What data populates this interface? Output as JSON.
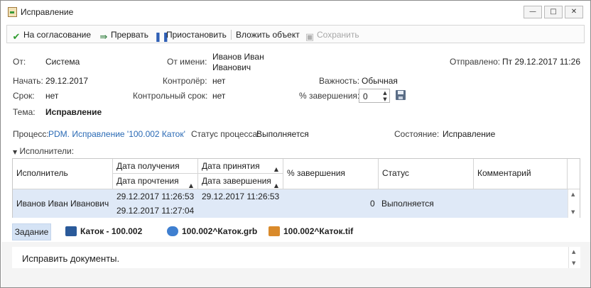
{
  "window": {
    "title": "Исправление",
    "minimize": "—",
    "maximize": "□",
    "close": "✕"
  },
  "toolbar": {
    "items": [
      {
        "label": "На согласование",
        "icon": "checkmark-icon"
      },
      {
        "label": "Прервать",
        "icon": "interrupt-icon"
      },
      {
        "label": "Приостановить",
        "icon": "pause-icon"
      },
      {
        "label": "Вложить объект"
      },
      {
        "label": "Сохранить",
        "icon": "save-icon",
        "disabled": true
      }
    ]
  },
  "fields": {
    "from_label": "От:",
    "from_value": "Система",
    "on_behalf_label": "От имени:",
    "on_behalf_value_line1": "Иванов Иван",
    "on_behalf_value_line2": "Иванович",
    "sent_label": "Отправлено:",
    "sent_value": "Пт 29.12.2017 11:26",
    "start_label": "Начать:",
    "start_value": "29.12.2017",
    "controller_label": "Контролёр:",
    "controller_value": "нет",
    "importance_label": "Важность:",
    "importance_value": "Обычная",
    "deadline_label": "Срок:",
    "deadline_value": "нет",
    "control_deadline_label": "Контрольный срок:",
    "control_deadline_value": "нет",
    "completion_label": "% завершения:",
    "completion_value": "0",
    "subject_label": "Тема:",
    "subject_value": "Исправление",
    "process_label": "Процесс:",
    "process_value": "PDM. Исправление '100.002 Каток'",
    "process_status_label": "Статус процесса:",
    "process_status_value": "Выполняется",
    "state_label": "Состояние:",
    "state_value": "Исправление"
  },
  "executors": {
    "section_label": "Исполнители:",
    "columns": {
      "executor": "Исполнитель",
      "received": "Дата получения",
      "read": "Дата прочтения",
      "accepted": "Дата принятия",
      "completed": "Дата завершения",
      "percent": "% завершения",
      "status": "Статус",
      "comment": "Комментарий"
    },
    "rows": [
      {
        "executor": "Иванов Иван Иванович",
        "received": "29.12.2017 11:26:53",
        "read": "29.12.2017 11:27:04",
        "accepted": "29.12.2017 11:26:53",
        "completed": "",
        "percent": "0",
        "status": "Выполняется",
        "comment": ""
      }
    ]
  },
  "attachments": {
    "tab_label": "Задание",
    "items": [
      {
        "label": "Каток - 100.002",
        "icon": "assembly-icon"
      },
      {
        "label": "100.002^Каток.grb",
        "icon": "drawing-icon"
      },
      {
        "label": "100.002^Каток.tif",
        "icon": "image-icon"
      }
    ]
  },
  "task_text": "Исправить документы.",
  "colors": {
    "accent": "#2a6ab5",
    "selected_row": "#dfe9f7",
    "tab_active": "#d5e3f5"
  }
}
